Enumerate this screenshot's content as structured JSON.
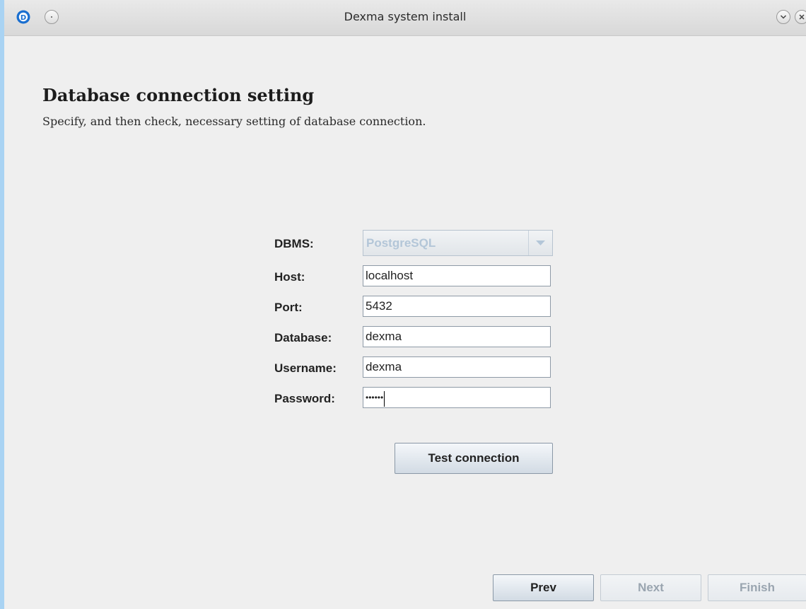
{
  "window": {
    "title": "Dexma system install",
    "app_icon": "dexma-logo-icon",
    "menu_icon": "window-menu-icon",
    "minimize_icon": "chevron-down-icon",
    "close_icon": "close-icon"
  },
  "header": {
    "title": "Database connection setting",
    "subtitle": "Specify, and then check, necessary setting of database connection."
  },
  "form": {
    "dbms": {
      "label": "DBMS:",
      "value": "PostgreSQL",
      "enabled": false
    },
    "host": {
      "label": "Host:",
      "value": "localhost"
    },
    "port": {
      "label": "Port:",
      "value": "5432"
    },
    "database": {
      "label": "Database:",
      "value": "dexma"
    },
    "username": {
      "label": "Username:",
      "value": "dexma"
    },
    "password": {
      "label": "Password:",
      "masked_value": "••••••"
    },
    "test_button": "Test connection"
  },
  "footer": {
    "prev": {
      "label": "Prev",
      "enabled": true
    },
    "next": {
      "label": "Next",
      "enabled": false
    },
    "finish": {
      "label": "Finish",
      "enabled": false
    }
  },
  "colors": {
    "accent": "#1a6fd0",
    "window_border": "#a9d3f3",
    "disabled_text": "#9aa5b0"
  }
}
